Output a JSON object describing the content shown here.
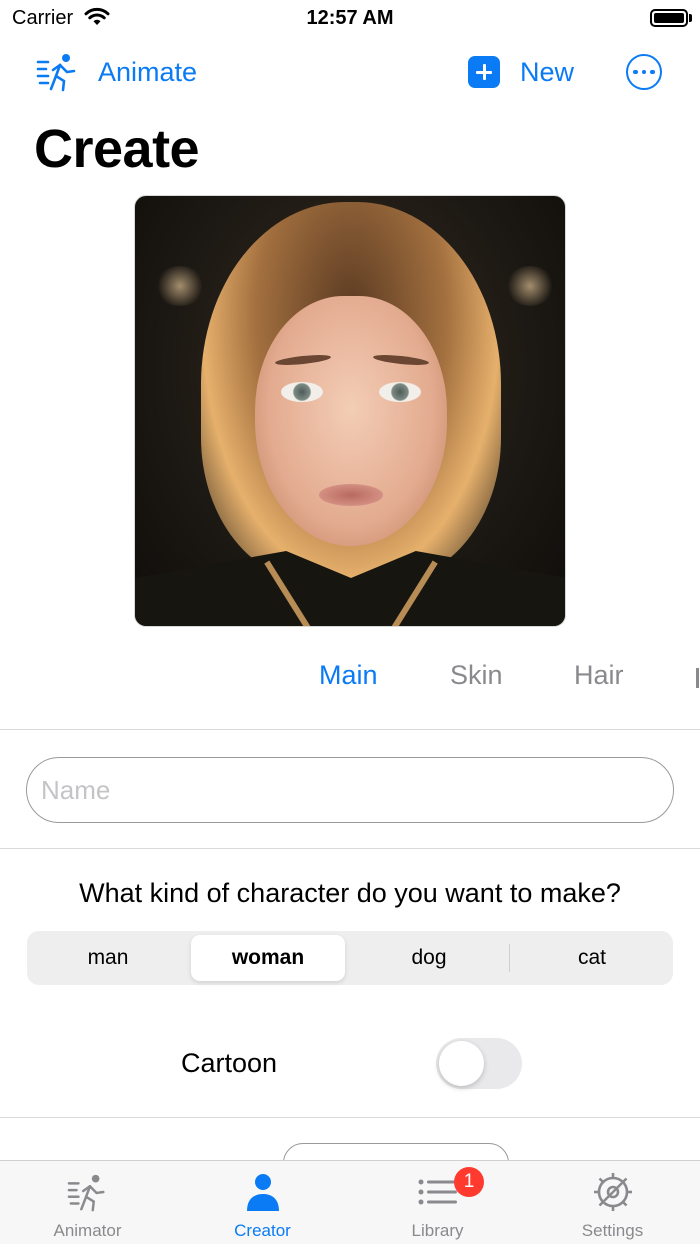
{
  "status_bar": {
    "carrier": "Carrier",
    "time": "12:57 AM"
  },
  "nav": {
    "animate_label": "Animate",
    "new_label": "New",
    "more_icon": "ellipsis-circle-icon"
  },
  "page": {
    "title": "Create"
  },
  "tabs": [
    {
      "label": "Main",
      "active": true
    },
    {
      "label": "Skin",
      "active": false
    },
    {
      "label": "Hair",
      "active": false
    }
  ],
  "form": {
    "name_placeholder": "Name",
    "name_value": "",
    "question": "What kind of character do you want to make?",
    "options": [
      "man",
      "woman",
      "dog",
      "cat"
    ],
    "selected_option": "woman",
    "cartoon_label": "Cartoon",
    "cartoon_enabled": false
  },
  "tabbar": {
    "items": [
      {
        "label": "Animator",
        "icon": "running-figure-icon",
        "active": false
      },
      {
        "label": "Creator",
        "icon": "person-icon",
        "active": true
      },
      {
        "label": "Library",
        "icon": "list-icon",
        "active": false,
        "badge": "1"
      },
      {
        "label": "Settings",
        "icon": "gear-icon",
        "active": false
      }
    ]
  },
  "colors": {
    "accent": "#0a7bf5",
    "badge": "#ff3b30",
    "inactive": "#8a8a8e"
  }
}
